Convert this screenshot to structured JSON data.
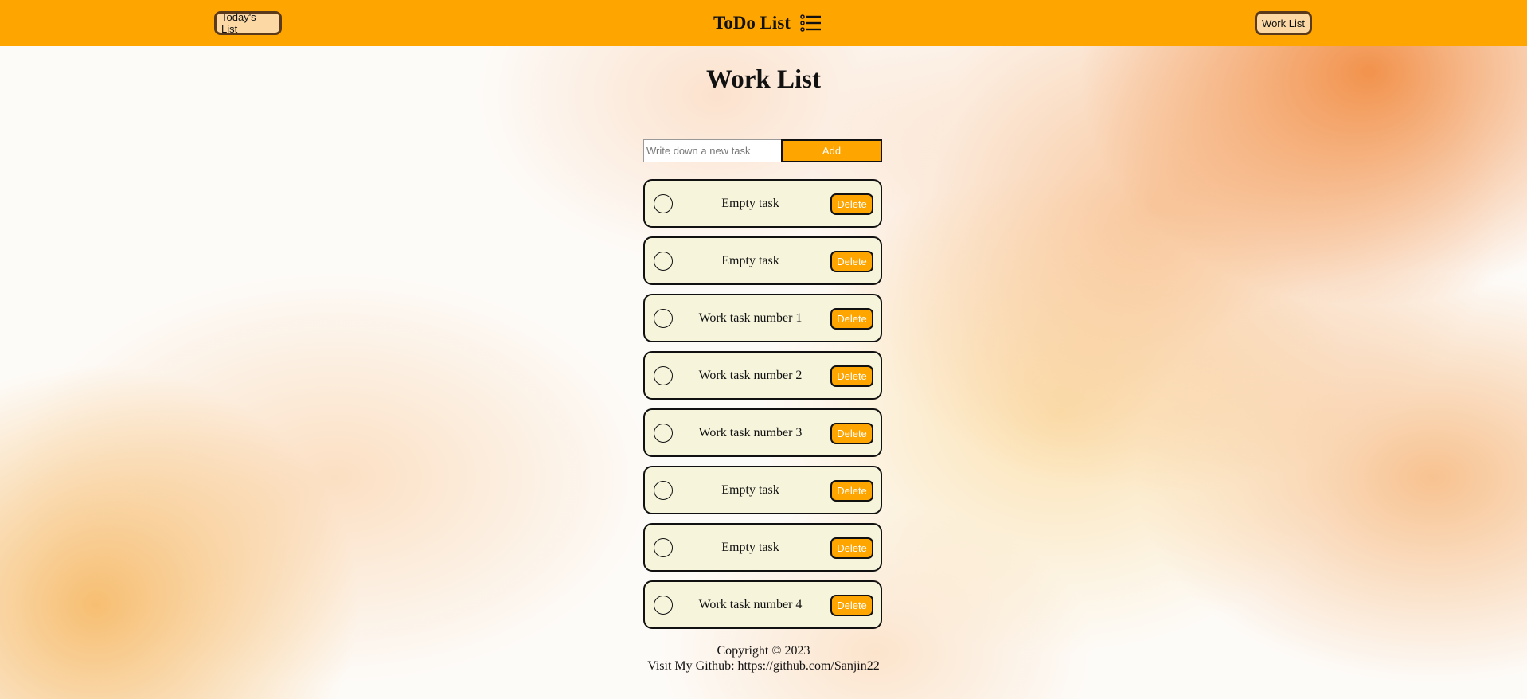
{
  "header": {
    "title": "ToDo List",
    "left_button": "Today's List",
    "right_button": "Work List",
    "menu_icon": "list-icon"
  },
  "page": {
    "title": "Work List"
  },
  "form": {
    "placeholder": "Write down a new task",
    "value": "",
    "add_label": "Add"
  },
  "tasks": [
    {
      "text": "Empty task",
      "delete_label": "Delete",
      "done": false
    },
    {
      "text": "Empty task",
      "delete_label": "Delete",
      "done": false
    },
    {
      "text": "Work task number 1",
      "delete_label": "Delete",
      "done": false
    },
    {
      "text": "Work task number 2",
      "delete_label": "Delete",
      "done": false
    },
    {
      "text": "Work task number 3",
      "delete_label": "Delete",
      "done": false
    },
    {
      "text": "Empty task",
      "delete_label": "Delete",
      "done": false
    },
    {
      "text": "Empty task",
      "delete_label": "Delete",
      "done": false
    },
    {
      "text": "Work task number 4",
      "delete_label": "Delete",
      "done": false
    }
  ],
  "footer": {
    "copyright": "Copyright © 2023",
    "github": "Visit My Github: https://github.com/Sanjin22"
  },
  "colors": {
    "accent": "#ffa500",
    "card": "#f6f5dc"
  }
}
